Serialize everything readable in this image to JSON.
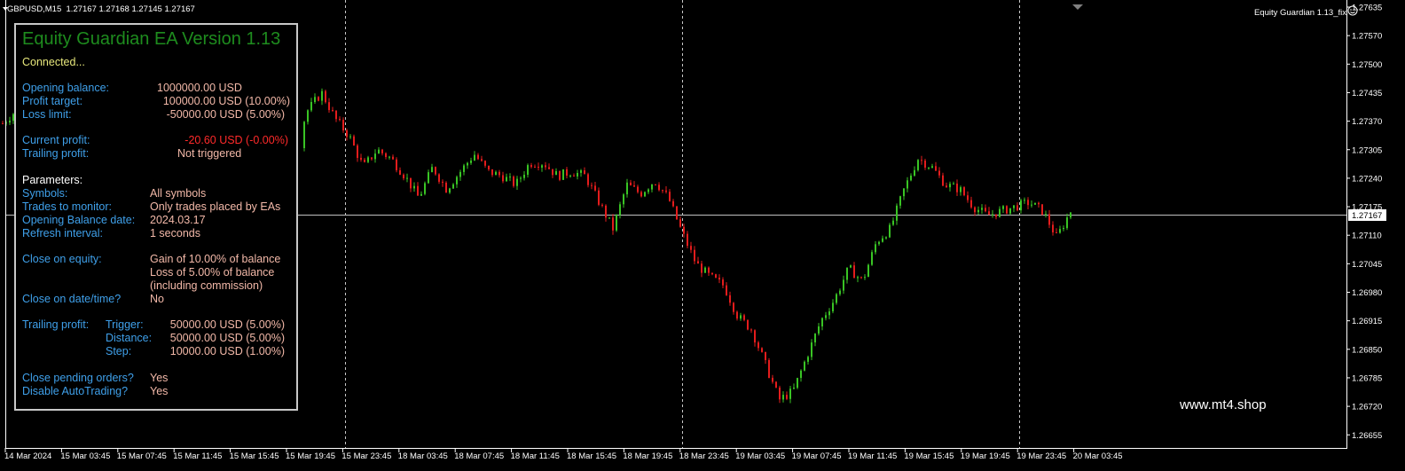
{
  "header": {
    "symbol_info": "GBPUSD,M15  1.27167 1.27168 1.27145 1.27167",
    "ea_label": "Equity Guardian 1.13_fix",
    "watermark": "www.mt4.shop"
  },
  "panel": {
    "title": "Equity Guardian EA Version 1.13",
    "status": "Connected...",
    "opening_balance_label": "Opening balance:",
    "opening_balance_value": "1000000.00 USD",
    "profit_target_label": "Profit target:",
    "profit_target_value": "100000.00 USD (10.00%)",
    "loss_limit_label": "Loss limit:",
    "loss_limit_value": "-50000.00 USD (5.00%)",
    "current_profit_label": "Current profit:",
    "current_profit_value": "-20.60 USD (-0.00%)",
    "trailing_profit_label": "Trailing profit:",
    "trailing_profit_value": "Not triggered",
    "parameters_heading": "Parameters:",
    "symbols_label": "Symbols:",
    "symbols_value": "All symbols",
    "trades_label": "Trades to monitor:",
    "trades_value": "Only trades placed by EAs",
    "ob_date_label": "Opening Balance date:",
    "ob_date_value": "2024.03.17",
    "refresh_label": "Refresh interval:",
    "refresh_value": "1 seconds",
    "close_equity_label": "Close on equity:",
    "close_equity_value_1": "Gain of 10.00% of balance",
    "close_equity_value_2": "Loss of 5.00% of balance",
    "close_equity_value_3": "(including commission)",
    "close_date_label": "Close on date/time?",
    "close_date_value": "No",
    "trailing_label": "Trailing profit:",
    "trigger_label": "Trigger:",
    "trigger_value": "50000.00 USD (5.00%)",
    "distance_label": "Distance:",
    "distance_value": "50000.00 USD (5.00%)",
    "step_label": "Step:",
    "step_value": "10000.00 USD (1.00%)",
    "close_pending_label": "Close pending orders?",
    "close_pending_value": "Yes",
    "disable_at_label": "Disable AutoTrading?",
    "disable_at_value": "Yes"
  },
  "chart_data": {
    "type": "candlestick",
    "symbol": "GBPUSD",
    "timeframe": "M15",
    "current_price": "1.27167",
    "price_ticks": [
      "1.27635",
      "1.27570",
      "1.27500",
      "1.27435",
      "1.27370",
      "1.27305",
      "1.27240",
      "1.27175",
      "1.27110",
      "1.27045",
      "1.26980",
      "1.26915",
      "1.26850",
      "1.26785",
      "1.26720",
      "1.26655"
    ],
    "time_ticks": [
      "14 Mar 2024",
      "15 Mar 03:45",
      "15 Mar 07:45",
      "15 Mar 11:45",
      "15 Mar 15:45",
      "15 Mar 19:45",
      "15 Mar 23:45",
      "18 Mar 03:45",
      "18 Mar 07:45",
      "18 Mar 11:45",
      "18 Mar 15:45",
      "18 Mar 19:45",
      "18 Mar 23:45",
      "19 Mar 03:45",
      "19 Mar 07:45",
      "19 Mar 11:45",
      "19 Mar 15:45",
      "19 Mar 19:45",
      "19 Mar 23:45",
      "20 Mar 03:45"
    ],
    "ylim": [
      1.2664,
      1.2765
    ],
    "path": [
      1.2737,
      1.274,
      1.2736,
      1.274,
      1.2725,
      1.273,
      1.2735,
      1.2731,
      1.2728,
      1.2732,
      1.273,
      1.2728,
      1.2733,
      1.2731,
      1.273,
      1.2734,
      1.2732,
      1.2737,
      1.2745,
      1.274,
      1.2736,
      1.2731,
      1.274,
      1.2744,
      1.2738,
      1.2734,
      1.2727,
      1.2731,
      1.2729,
      1.2725,
      1.272,
      1.2727,
      1.2722,
      1.2726,
      1.273,
      1.2726,
      1.2725,
      1.2723,
      1.2728,
      1.2728,
      1.2725,
      1.2726,
      1.2725,
      1.2719,
      1.2713,
      1.2723,
      1.2721,
      1.2724,
      1.272,
      1.2712,
      1.2705,
      1.2702,
      1.27,
      1.2693,
      1.269,
      1.2682,
      1.2674,
      1.2676,
      1.2684,
      1.2692,
      1.2697,
      1.2704,
      1.2701,
      1.271,
      1.2713,
      1.2722,
      1.2729,
      1.2727,
      1.2723,
      1.2722,
      1.2718,
      1.2716,
      1.2717,
      1.2718,
      1.2719,
      1.2717,
      1.2711,
      1.2717
    ]
  }
}
